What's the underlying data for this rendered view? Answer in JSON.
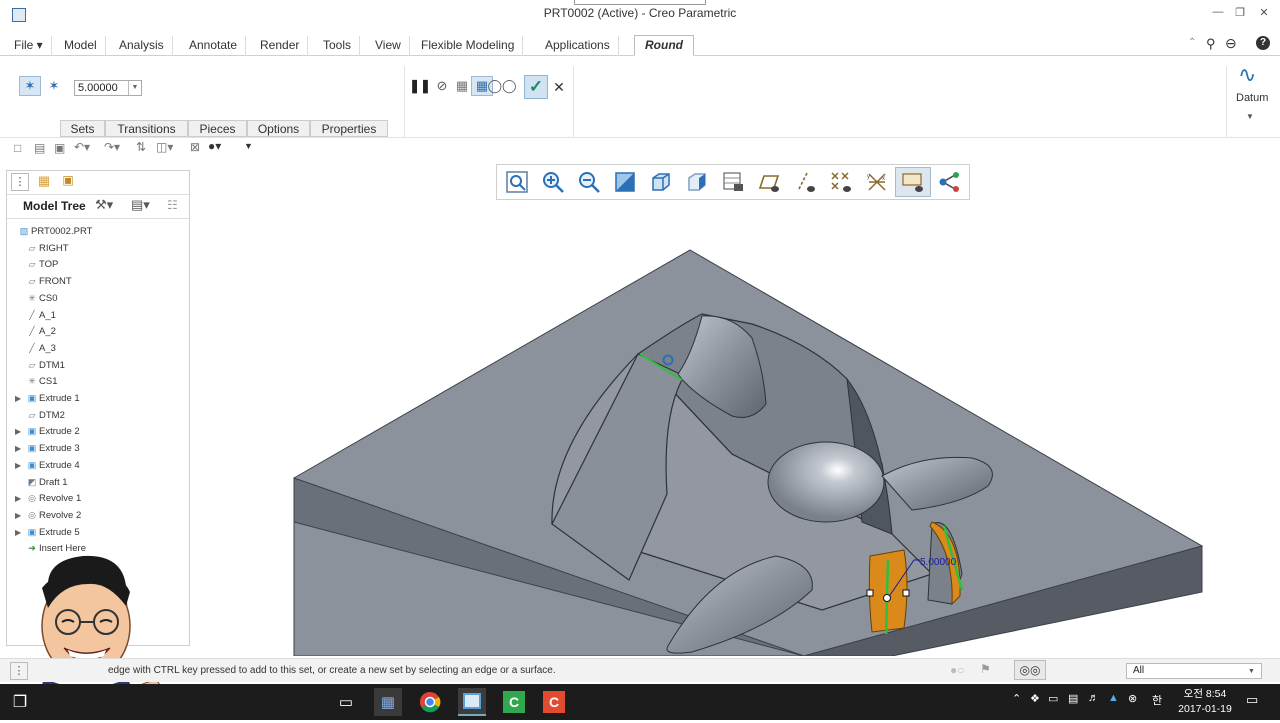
{
  "window": {
    "title": "PRT0002 (Active) - Creo Parametric"
  },
  "menu_tabs": [
    {
      "label": "File",
      "has_dropdown": true
    },
    {
      "label": "Model"
    },
    {
      "label": "Analysis"
    },
    {
      "label": "Annotate"
    },
    {
      "label": "Render"
    },
    {
      "label": "Tools"
    },
    {
      "label": "View"
    },
    {
      "label": "Flexible Modeling"
    },
    {
      "label": "Applications"
    },
    {
      "label": "Round",
      "active": true
    }
  ],
  "ribbon": {
    "radius_value": "5.00000",
    "subtabs": [
      "Sets",
      "Transitions",
      "Pieces",
      "Options",
      "Properties"
    ],
    "datum_label": "Datum"
  },
  "model_tree": {
    "title": "Model Tree",
    "items": [
      {
        "label": "PRT0002.PRT",
        "icon": "part-icon",
        "expandable": false
      },
      {
        "label": "RIGHT",
        "icon": "datum-plane-icon",
        "expandable": false
      },
      {
        "label": "TOP",
        "icon": "datum-plane-icon",
        "expandable": false
      },
      {
        "label": "FRONT",
        "icon": "datum-plane-icon",
        "expandable": false
      },
      {
        "label": "CS0",
        "icon": "csys-icon",
        "expandable": false
      },
      {
        "label": "A_1",
        "icon": "datum-axis-icon",
        "expandable": false
      },
      {
        "label": "A_2",
        "icon": "datum-axis-icon",
        "expandable": false
      },
      {
        "label": "A_3",
        "icon": "datum-axis-icon",
        "expandable": false
      },
      {
        "label": "DTM1",
        "icon": "datum-plane-icon",
        "expandable": false
      },
      {
        "label": "CS1",
        "icon": "csys-icon",
        "expandable": false
      },
      {
        "label": "Extrude 1",
        "icon": "extrude-icon",
        "expandable": true
      },
      {
        "label": "DTM2",
        "icon": "datum-plane-icon",
        "expandable": false
      },
      {
        "label": "Extrude 2",
        "icon": "extrude-icon",
        "expandable": true
      },
      {
        "label": "Extrude 3",
        "icon": "extrude-icon",
        "expandable": true
      },
      {
        "label": "Extrude 4",
        "icon": "extrude-icon",
        "expandable": true
      },
      {
        "label": "Draft 1",
        "icon": "draft-icon",
        "expandable": false
      },
      {
        "label": "Revolve 1",
        "icon": "revolve-icon",
        "expandable": true
      },
      {
        "label": "Revolve 2",
        "icon": "revolve-icon",
        "expandable": true
      },
      {
        "label": "Extrude 5",
        "icon": "extrude-icon",
        "expandable": true
      },
      {
        "label": "Insert Here",
        "icon": "insert-here-icon",
        "expandable": false
      }
    ]
  },
  "viewport": {
    "dimension_label": "5.00000"
  },
  "status": {
    "message": "edge with CTRL key pressed to add to this set, or create a new set by selecting an edge or a surface.",
    "filter_value": "All"
  },
  "taskbar": {
    "time": "오전 8:54",
    "date": "2017-01-19",
    "ime": "한"
  },
  "colors": {
    "accent": "#2b6fb4",
    "model_gray": "#8e949d",
    "round_orange": "#d98a1a",
    "taskbar": "#1c1c1c"
  }
}
